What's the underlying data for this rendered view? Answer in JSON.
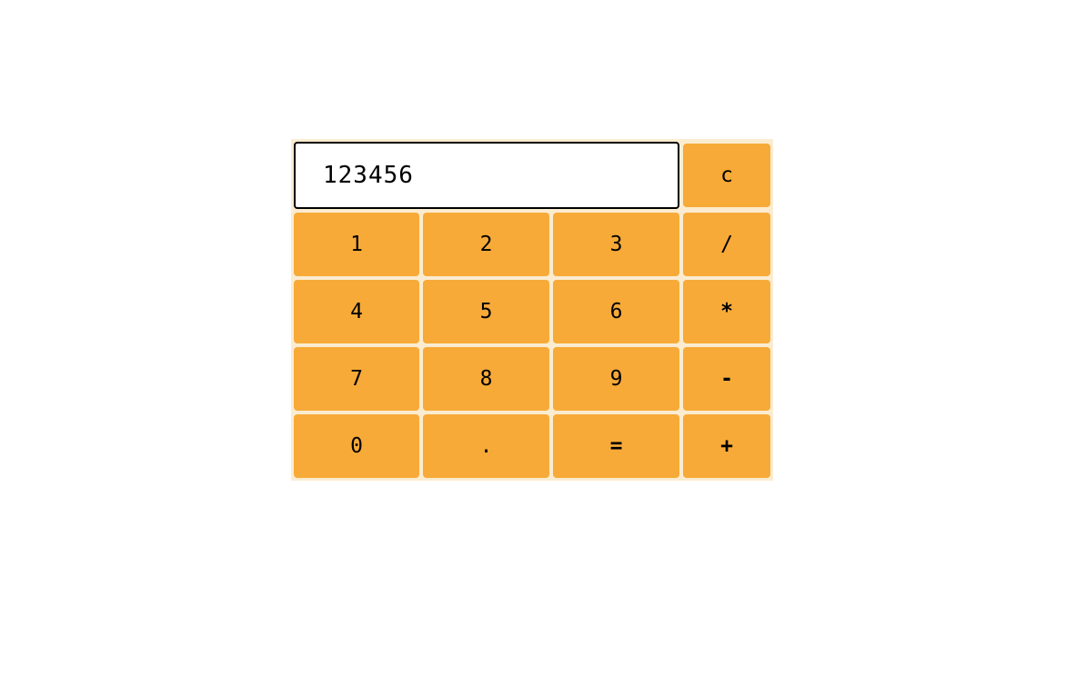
{
  "display": {
    "value": "123456"
  },
  "keys": {
    "clear": "c",
    "one": "1",
    "two": "2",
    "three": "3",
    "divide": "/",
    "four": "4",
    "five": "5",
    "six": "6",
    "multiply": "*",
    "seven": "7",
    "eight": "8",
    "nine": "9",
    "subtract": "-",
    "zero": "0",
    "decimal": ".",
    "equals": "=",
    "add": "+"
  },
  "colors": {
    "key_background": "#f7aa38",
    "panel_background": "#fbecd0",
    "display_background": "#ffffff",
    "text": "#000000"
  }
}
